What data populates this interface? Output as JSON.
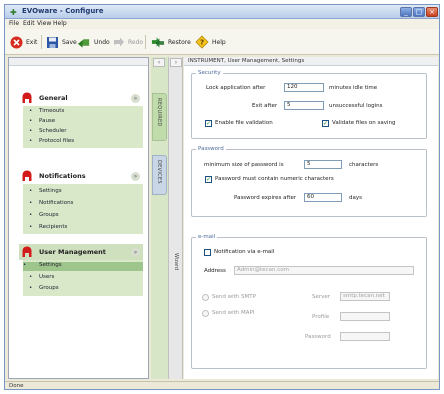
{
  "window": {
    "title": "EVOware - Configure",
    "controls": {
      "minimize": "_",
      "maximize": "□",
      "close": "×"
    }
  },
  "menu": {
    "file": "File",
    "edit": "Edit",
    "view": "View",
    "help": "Help"
  },
  "toolbar": {
    "exit": "Exit",
    "save": "Save",
    "undo": "Undo",
    "redo": "Redo",
    "restore": "Restore",
    "help": "Help"
  },
  "icons": {
    "exit": "exit-icon",
    "save": "save-icon",
    "undo": "undo-icon",
    "redo": "redo-icon",
    "restore": "restore-icon",
    "help": "help-icon",
    "section": "head-icon"
  },
  "colors": {
    "section_icon": "#d21b1b",
    "nav_bg": "#d8e8c8",
    "nav_selected": "#9ec58b",
    "group_title": "#4a6b9a"
  },
  "sidebar": {
    "sections": [
      {
        "title": "General",
        "items": [
          "Timeouts",
          "Pause",
          "Scheduler",
          "Protocol files"
        ]
      },
      {
        "title": "Notifications",
        "items": [
          "Settings",
          "Notifications",
          "Groups",
          "Recipients"
        ]
      },
      {
        "title": "User Management",
        "items": [
          "Settings",
          "Users",
          "Groups"
        ],
        "selected": "Settings"
      }
    ]
  },
  "tabs": {
    "tab1": "REQUIRED",
    "tab2": "DEVICES",
    "wizard": "Wizard"
  },
  "main": {
    "breadcrumb": "INSTRUMENT, User Management, Settings",
    "security": {
      "title": "Security",
      "lock_label": "Lock application after",
      "lock_value": "120",
      "lock_unit": "minutes idle time",
      "exit_label": "Exit after",
      "exit_value": "5",
      "exit_unit": "unsuccessful logins",
      "file_validation_label": "Enable file validation",
      "validate_saving_label": "Validate files on saving"
    },
    "password": {
      "title": "Password",
      "min_size_label": "minimum size of password is",
      "min_size_value": "5",
      "min_size_unit": "characters",
      "numeric_label": "Password must contain numeric characters",
      "expires_label": "Password expires after",
      "expires_value": "60",
      "expires_unit": "days"
    },
    "email": {
      "title": "e-mail",
      "notify_label": "Notification via e-mail",
      "address_label": "Address",
      "address_placeholder": "Admin@tecan.com",
      "smtp_label": "Send with SMTP",
      "mapi_label": "Send with MAPI",
      "server_label": "Server",
      "server_placeholder": "smtp.tecan.net",
      "profile_label": "Profile",
      "password_label": "Password"
    }
  },
  "status": {
    "text": "Done"
  }
}
